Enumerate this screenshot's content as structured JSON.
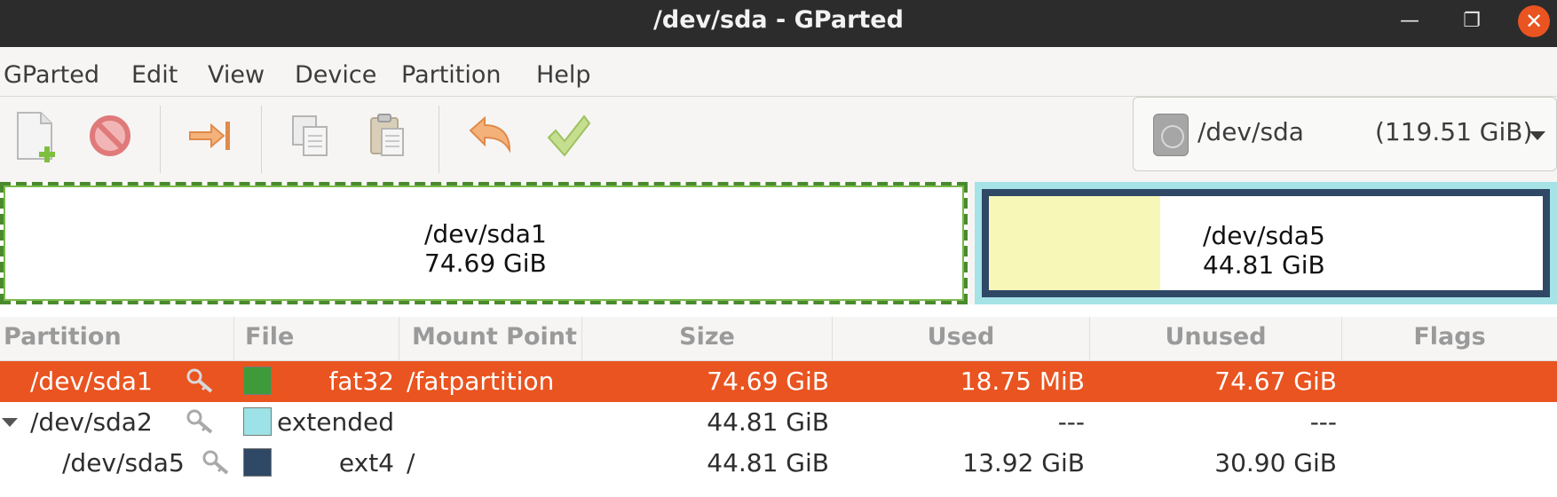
{
  "window": {
    "title": "/dev/sda - GParted",
    "minimize_glyph": "—",
    "maximize_glyph": "❐",
    "close_glyph": "✕"
  },
  "menu": [
    "GParted",
    "Edit",
    "View",
    "Device",
    "Partition",
    "Help"
  ],
  "toolbar": {
    "buttons": [
      "new-icon",
      "delete-icon",
      "resize-move-icon",
      "copy-icon",
      "paste-icon",
      "undo-icon",
      "apply-icon"
    ]
  },
  "device_selector": {
    "device": "/dev/sda",
    "size": "(119.51 GiB)",
    "icon": "disk-icon"
  },
  "partition_map": {
    "sda1": {
      "name": "/dev/sda1",
      "size": "74.69 GiB",
      "color": "#4a8a2e"
    },
    "sda5": {
      "name": "/dev/sda5",
      "size": "44.81 GiB",
      "color": "#2f4866",
      "used_fraction": 0.31
    },
    "extended_color": "#a5e3e6"
  },
  "table": {
    "headers": [
      "Partition",
      "File System",
      "Mount Point",
      "Size",
      "Used",
      "Unused",
      "Flags"
    ],
    "rows": [
      {
        "partition": "/dev/sda1",
        "filesystem": "fat32",
        "fs_color": "#3f9a3a",
        "mount": "/fatpartition",
        "size": "74.69 GiB",
        "used": "18.75 MiB",
        "unused": "74.67 GiB",
        "flags": "",
        "selected": true
      },
      {
        "partition": "/dev/sda2",
        "filesystem": "extended",
        "fs_color": "#9de2e6",
        "mount": "",
        "size": "44.81 GiB",
        "used": "---",
        "unused": "---",
        "flags": ""
      },
      {
        "partition": "/dev/sda5",
        "filesystem": "ext4",
        "fs_color": "#2f4866",
        "mount": "/",
        "size": "44.81 GiB",
        "used": "13.92 GiB",
        "unused": "30.90 GiB",
        "flags": ""
      }
    ]
  }
}
